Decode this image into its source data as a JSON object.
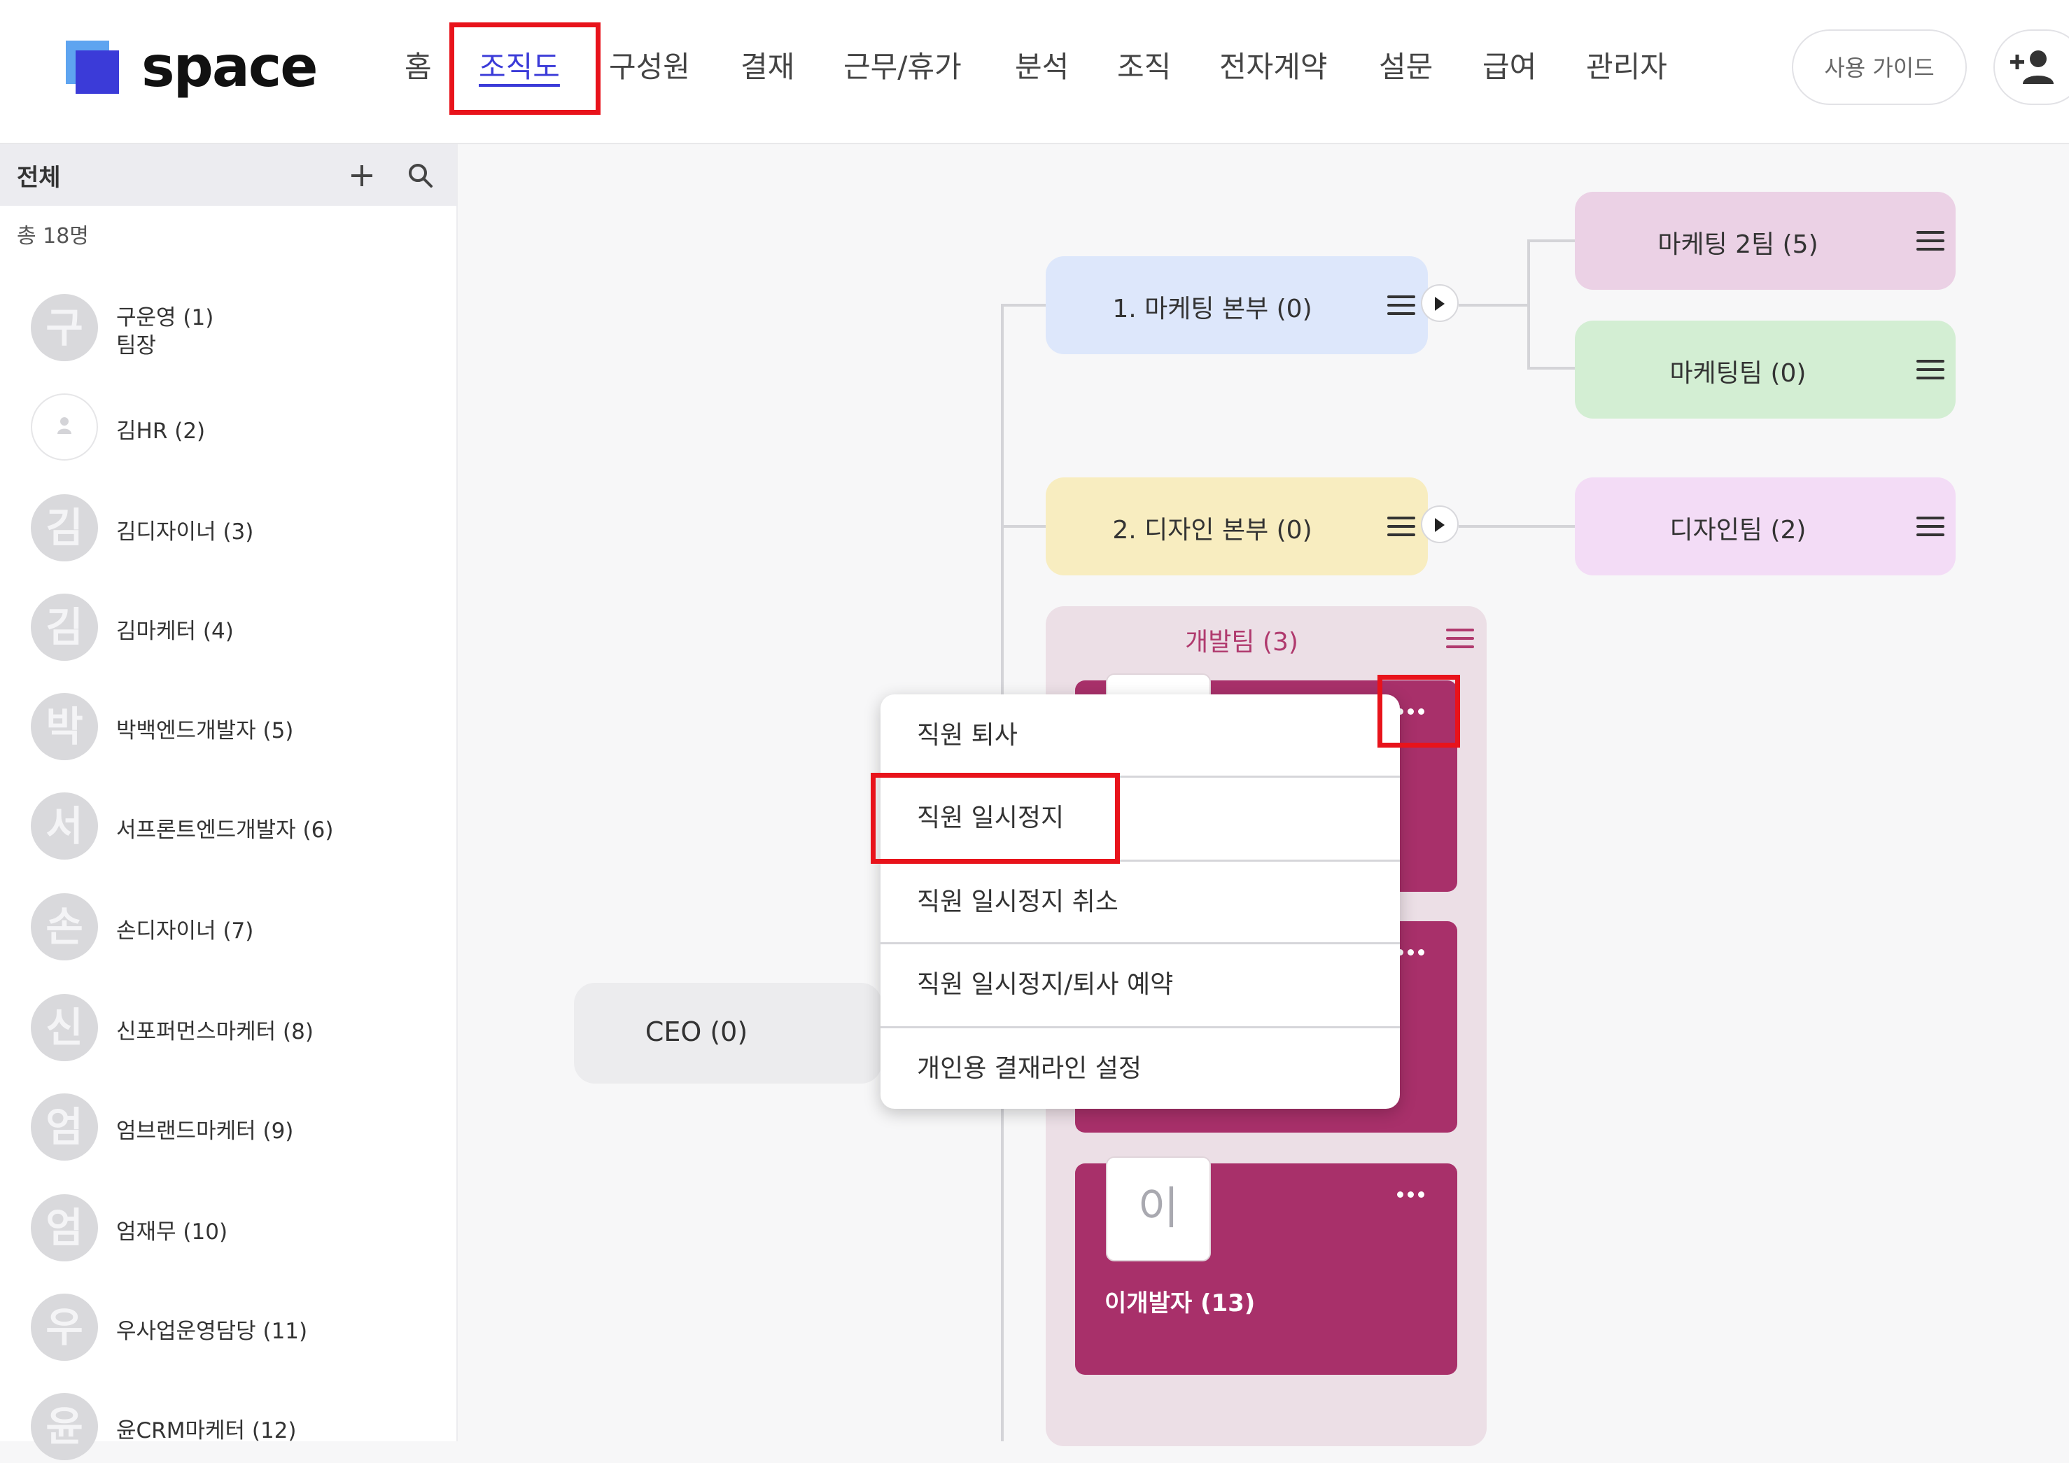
{
  "header": {
    "logo_text": "space",
    "nav": [
      "홈",
      "조직도",
      "구성원",
      "결재",
      "근무/휴가",
      "분석",
      "조직",
      "전자계약",
      "설문",
      "급여",
      "관리자"
    ],
    "active_nav": "조직도",
    "guide_label": "사용 가이드"
  },
  "sidebar": {
    "title": "전체",
    "count": "총 18명",
    "members": [
      {
        "avatar": "구",
        "name": "구운영 (1)",
        "role": "팀장"
      },
      {
        "avatar": "",
        "name": "김HR (2)",
        "role": ""
      },
      {
        "avatar": "김",
        "name": "김디자이너 (3)",
        "role": ""
      },
      {
        "avatar": "김",
        "name": "김마케터 (4)",
        "role": ""
      },
      {
        "avatar": "박",
        "name": "박백엔드개발자 (5)",
        "role": ""
      },
      {
        "avatar": "서",
        "name": "서프론트엔드개발자 (6)",
        "role": ""
      },
      {
        "avatar": "손",
        "name": "손디자이너 (7)",
        "role": ""
      },
      {
        "avatar": "신",
        "name": "신포퍼먼스마케터 (8)",
        "role": ""
      },
      {
        "avatar": "엄",
        "name": "엄브랜드마케터 (9)",
        "role": ""
      },
      {
        "avatar": "엄",
        "name": "엄재무 (10)",
        "role": ""
      },
      {
        "avatar": "우",
        "name": "우사업운영담당 (11)",
        "role": ""
      },
      {
        "avatar": "윤",
        "name": "윤CRM마케터 (12)",
        "role": ""
      }
    ]
  },
  "org": {
    "ceo": "CEO (0)",
    "dept_marketing": "1. 마케팅 본부 (0)",
    "dept_design": "2. 디자인 본부 (0)",
    "team_marketing2": "마케팅 2팀 (5)",
    "team_marketing": "마케팅팀 (0)",
    "team_design": "디자인팀 (2)",
    "team_dev": "개발팀 (3)",
    "dev_member_avatar": "이",
    "dev_member_name": "이개발자 (13)"
  },
  "context_menu": {
    "items": [
      "직원 퇴사",
      "직원 일시정지",
      "직원 일시정지 취소",
      "직원 일시정지/퇴사 예약",
      "개인용 결재라인 설정"
    ]
  },
  "colors": {
    "accent": "#3b3bd8",
    "highlight": "#e8131b",
    "marketing_dept": "#dde7fb",
    "design_dept": "#f8edc0",
    "marketing2_team": "#ebd1e5",
    "marketing_team": "#d3eed3",
    "design_team": "#f3dcf6",
    "dev_card": "#a8306a"
  }
}
